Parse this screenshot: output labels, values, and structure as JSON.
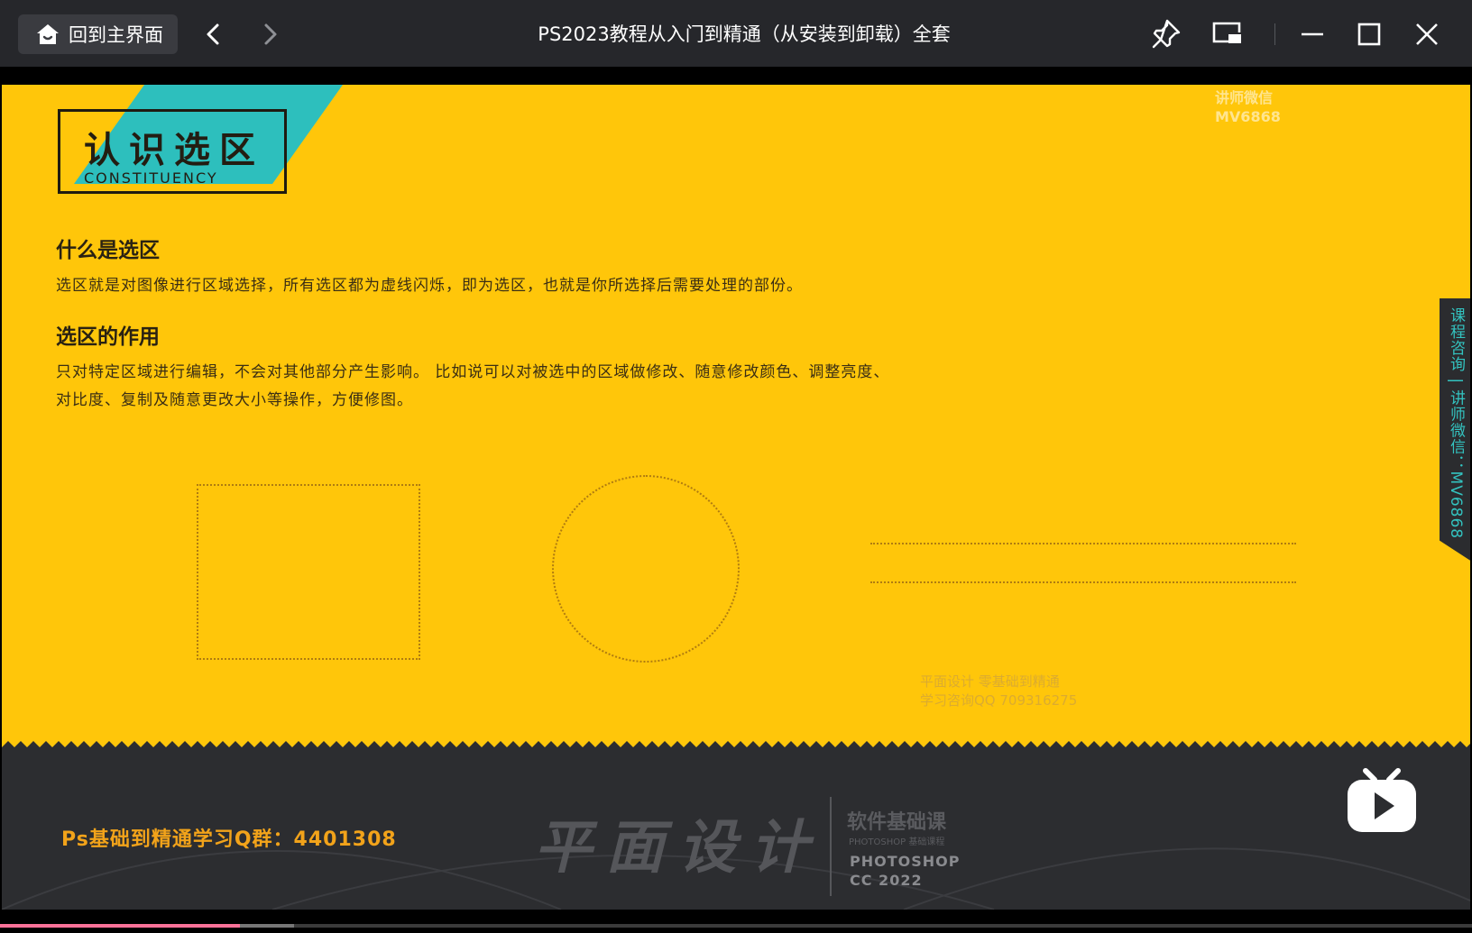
{
  "titlebar": {
    "home_label": "回到主界面",
    "window_title": "PS2023教程从入门到精通（从安装到卸载）全套"
  },
  "slide": {
    "title_main": "认识选区",
    "title_sub": "CONSTITUENCY",
    "watermark_top": [
      "讲师微信",
      "MV6868"
    ],
    "section1": {
      "heading": "什么是选区",
      "text": "选区就是对图像进行区域选择，所有选区都为虚线闪烁，即为选区，也就是你所选择后需要处理的部份。"
    },
    "section2": {
      "heading": "选区的作用",
      "lines": [
        "只对特定区域进行编辑，不会对其他部分产生影响。 比如说可以对被选中的区域做修改、随意修改颜色、调整亮度、",
        "对比度、复制及随意更改大小等操作，方便修图。"
      ]
    },
    "watermark_center": [
      "平面设计 零基础到精通",
      "学习咨询QQ 709316275"
    ],
    "side_tab": "课程咨询 | 讲师微信：MV6868",
    "qq_group": "Ps基础到精通学习Q群：4401308",
    "logo": {
      "main": "平面设计",
      "r1": "软件基础课",
      "r2": "PHOTOSHOP 基础课程",
      "r3": "PHOTOSHOP",
      "r4": "CC 2022"
    }
  },
  "player": {
    "progress": 0.163,
    "buffered": 0.2
  },
  "colors": {
    "slide_bg": "#ffc60a",
    "accent_teal": "#2dbfbd",
    "dark_band": "#2c2d30",
    "progress_pink": "#fb7299",
    "qq_orange": "#f2a31a"
  }
}
